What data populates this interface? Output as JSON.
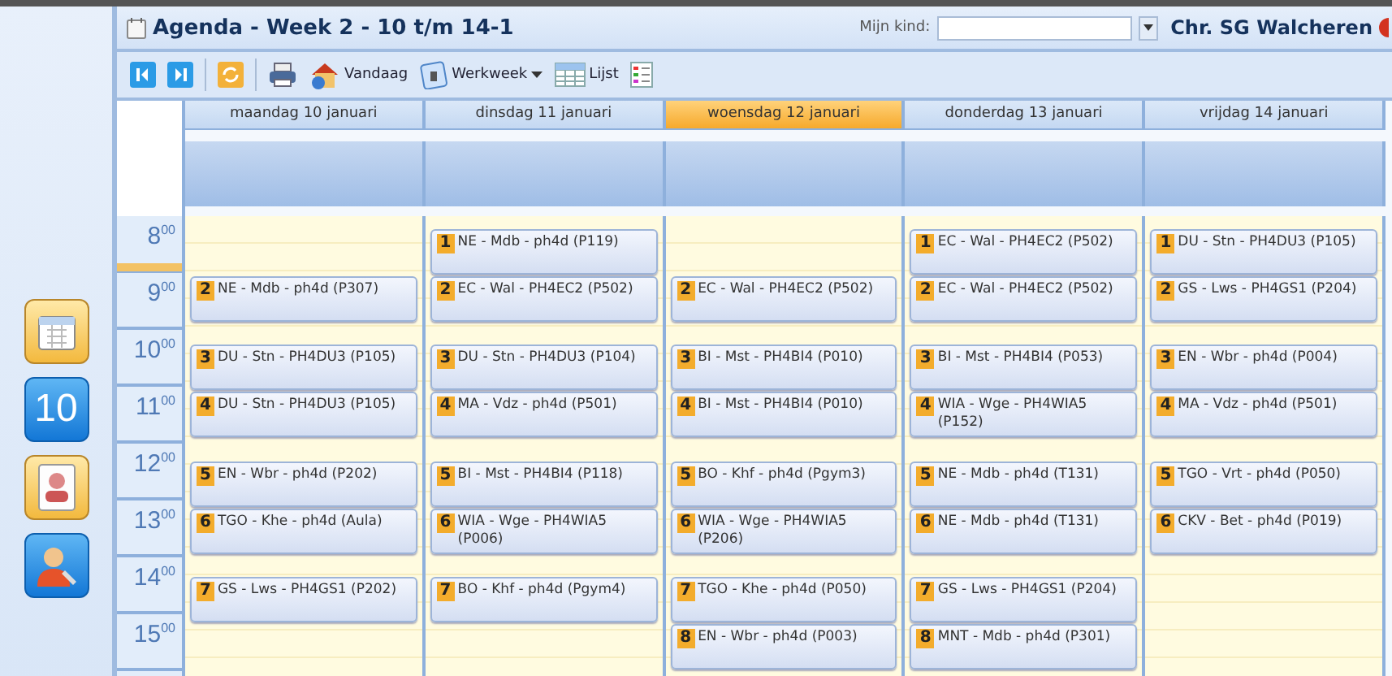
{
  "sidebar": {
    "items": [
      {
        "kind": "calendar"
      },
      {
        "kind": "date",
        "label": "10"
      },
      {
        "kind": "card"
      },
      {
        "kind": "tools"
      }
    ]
  },
  "window": {
    "title": "Agenda - Week 2 - 10 t/m 14-1"
  },
  "child_picker": {
    "label": "Mijn kind:"
  },
  "school": "Chr. SG Walcheren",
  "toolbar": [
    {
      "kind": "prev"
    },
    {
      "kind": "next"
    },
    {
      "kind": "refresh"
    },
    {
      "kind": "print"
    },
    {
      "kind": "today",
      "label": "Vandaag"
    },
    {
      "kind": "workweek",
      "label": "Werkweek",
      "dropdown": true
    },
    {
      "kind": "list",
      "label": "Lijst"
    },
    {
      "kind": "legend"
    }
  ],
  "hours": [
    "8$^{00}$",
    "9$^{00}$",
    "10$^{00}$",
    "11$^{00}$",
    "12$^{00}$",
    "13$^{00}$",
    "14$^{00}$",
    "15$^{00}$"
  ],
  "days": [
    {
      "label": "maandag 10 januari",
      "selected": false,
      "lessons": [
        {
          "period": "2",
          "text": "NE - Mdb - ph4d  (P307)"
        },
        {
          "period": "3",
          "text": "DU - Stn - PH4DU3 (P105)"
        },
        {
          "period": "4",
          "text": "DU - Stn - PH4DU3 (P105)"
        },
        {
          "period": "5",
          "text": "EN - Wbr - ph4d  (P202)"
        },
        {
          "period": "6",
          "text": "TGO - Khe - ph4d  (Aula)"
        },
        {
          "period": "7",
          "text": "GS - Lws - PH4GS1 (P202)"
        }
      ]
    },
    {
      "label": "dinsdag 11 januari",
      "selected": false,
      "lessons": [
        {
          "period": "1",
          "text": "NE - Mdb - ph4d  (P119)"
        },
        {
          "period": "2",
          "text": "EC - Wal - PH4EC2  (P502)"
        },
        {
          "period": "3",
          "text": "DU - Stn - PH4DU3 (P104)"
        },
        {
          "period": "4",
          "text": "MA - Vdz - ph4d  (P501)"
        },
        {
          "period": "5",
          "text": "BI - Mst - PH4BI4  (P118)"
        },
        {
          "period": "6",
          "text": "WIA - Wge - PH4WIA5 (P006)"
        },
        {
          "period": "7",
          "text": "BO - Khf - ph4d  (Pgym4)"
        }
      ]
    },
    {
      "label": "woensdag 12 januari",
      "selected": true,
      "lessons": [
        {
          "period": "2",
          "text": "EC - Wal - PH4EC2  (P502)"
        },
        {
          "period": "3",
          "text": "BI - Mst - PH4BI4  (P010)"
        },
        {
          "period": "4",
          "text": "BI - Mst - PH4BI4  (P010)"
        },
        {
          "period": "5",
          "text": "BO - Khf - ph4d  (Pgym3)"
        },
        {
          "period": "6",
          "text": "WIA - Wge - PH4WIA5 (P206)"
        },
        {
          "period": "7",
          "text": "TGO - Khe - ph4d  (P050)"
        },
        {
          "period": "8",
          "text": "EN - Wbr - ph4d  (P003)"
        }
      ]
    },
    {
      "label": "donderdag 13 januari",
      "selected": false,
      "lessons": [
        {
          "period": "1",
          "text": "EC - Wal - PH4EC2  (P502)"
        },
        {
          "period": "2",
          "text": "EC - Wal - PH4EC2  (P502)"
        },
        {
          "period": "3",
          "text": "BI - Mst - PH4BI4  (P053)"
        },
        {
          "period": "4",
          "text": "WIA - Wge - PH4WIA5 (P152)"
        },
        {
          "period": "5",
          "text": "NE - Mdb - ph4d  (T131)"
        },
        {
          "period": "6",
          "text": "NE - Mdb - ph4d  (T131)"
        },
        {
          "period": "7",
          "text": "GS - Lws - PH4GS1 (P204)"
        },
        {
          "period": "8",
          "text": "MNT - Mdb - ph4d  (P301)"
        }
      ]
    },
    {
      "label": "vrijdag 14 januari",
      "selected": false,
      "lessons": [
        {
          "period": "1",
          "text": "DU - Stn - PH4DU3 (P105)"
        },
        {
          "period": "2",
          "text": "GS - Lws - PH4GS1 (P204)"
        },
        {
          "period": "3",
          "text": "EN - Wbr - ph4d  (P004)"
        },
        {
          "period": "4",
          "text": "MA - Vdz - ph4d  (P501)"
        },
        {
          "period": "5",
          "text": "TGO - Vrt - ph4d  (P050)"
        },
        {
          "period": "6",
          "text": "CKV - Bet - ph4d  (P019)"
        }
      ]
    }
  ]
}
